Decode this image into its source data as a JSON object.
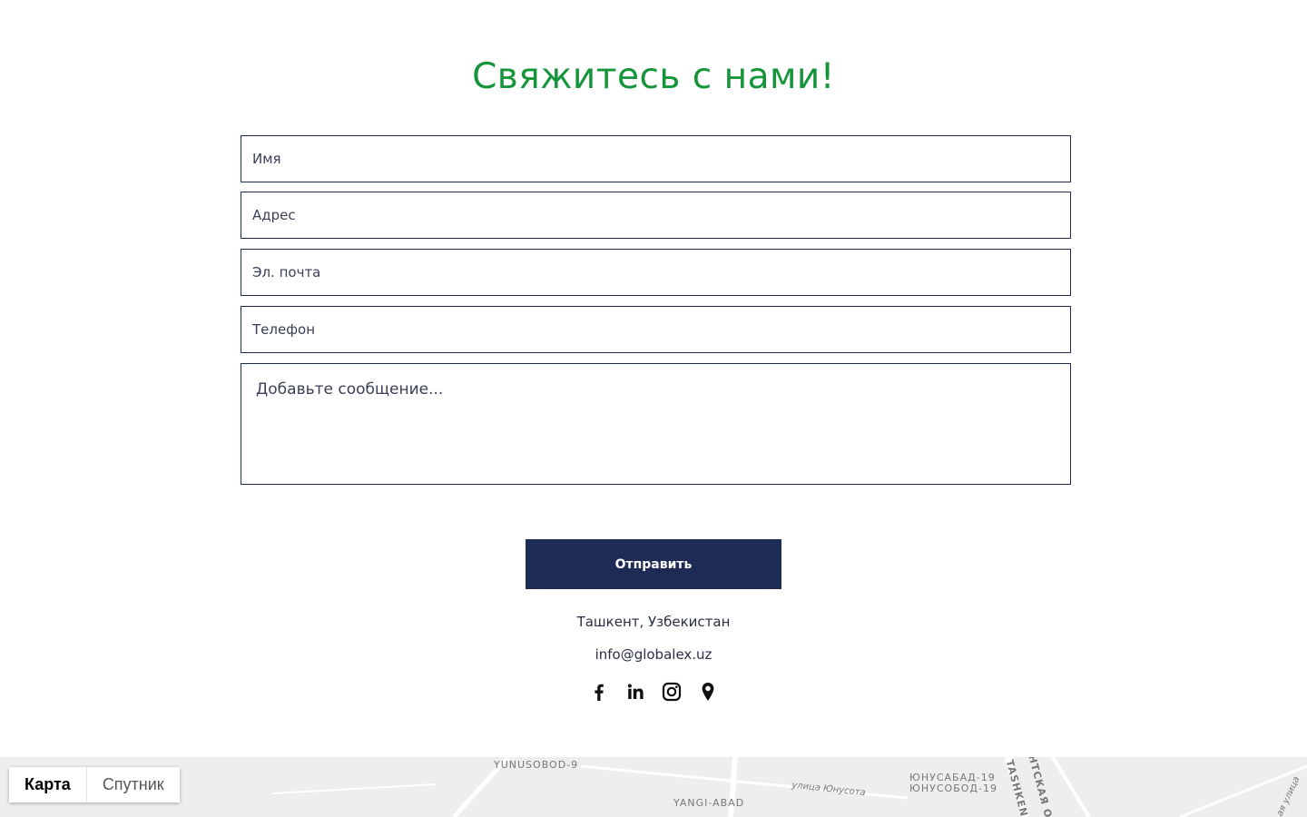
{
  "title": "Свяжитесь с нами!",
  "form": {
    "name_placeholder": "Имя",
    "address_placeholder": "Адрес",
    "email_placeholder": "Эл. почта",
    "phone_placeholder": "Телефон",
    "message_placeholder": "Добавьте сообщение...",
    "submit_label": "Отправить"
  },
  "contact": {
    "location": "Ташкент, Узбекистан",
    "email": "info@globalex.uz"
  },
  "socials": [
    "facebook-icon",
    "linkedin-icon",
    "instagram-icon",
    "location-pin-icon"
  ],
  "map": {
    "labels": {
      "yunusobod_9": "YUNUSOBOD-9",
      "yangi_abad": "YANGI-ABAD",
      "street_yunusota": "улица Юнусота",
      "yunusabad_19": "ЮНУСАБАД-19",
      "yunusobod_19": "ЮНУСОБОД-19",
      "tashkent_partial": "TASHKEN",
      "ring_partial": "НТСКАЯ О",
      "street_partial": "ая улица"
    },
    "toggle": {
      "map_label": "Карта",
      "satellite_label": "Спутник"
    }
  },
  "colors": {
    "title": "#15953a",
    "button": "#1e2b55",
    "border": "#1f2a4f"
  }
}
